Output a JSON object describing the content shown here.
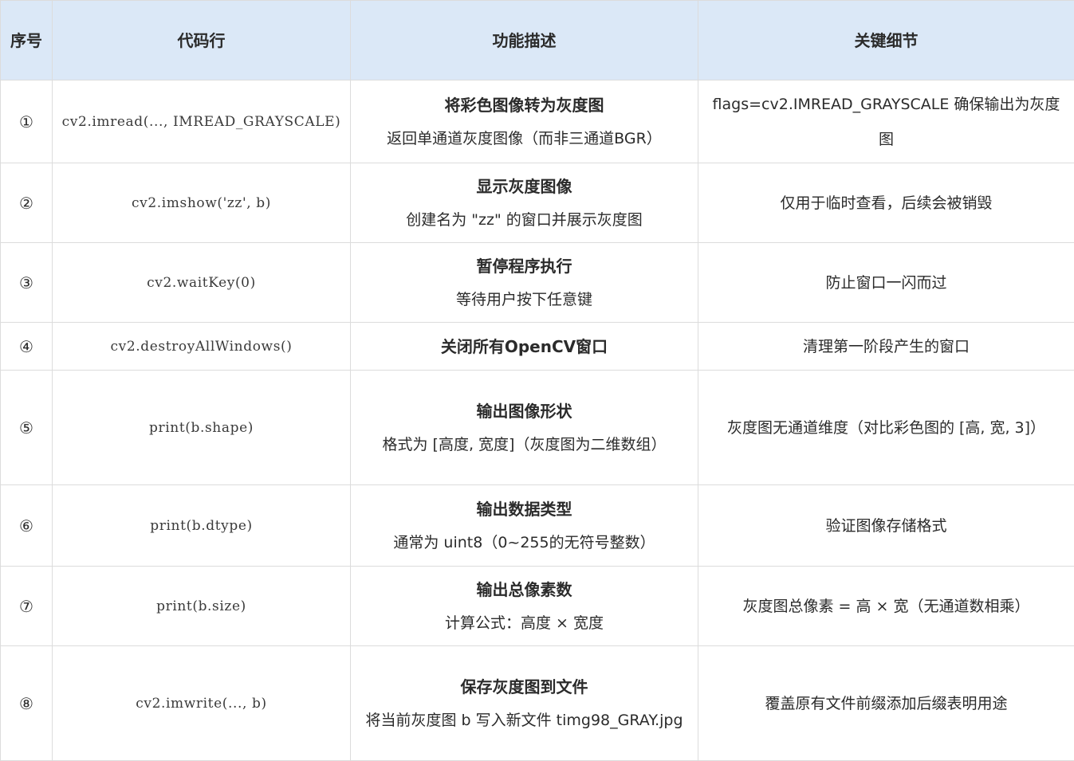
{
  "headers": {
    "num": "序号",
    "code": "代码行",
    "desc": "功能描述",
    "detail": "关键细节"
  },
  "rows": [
    {
      "num": "①",
      "code": "cv2.imread(..., IMREAD_GRAYSCALE)",
      "title": "将彩色图像转为灰度图",
      "sub": "返回单通道灰度图像（而非三通道BGR）",
      "detail": "flags=cv2.IMREAD_GRAYSCALE 确保输出为灰度图"
    },
    {
      "num": "②",
      "code": "cv2.imshow('zz', b)",
      "title": "显示灰度图像",
      "sub": "创建名为 \"zz\" 的窗口并展示灰度图",
      "detail": "仅用于临时查看，后续会被销毁"
    },
    {
      "num": "③",
      "code": "cv2.waitKey(0)",
      "title": "暂停程序执行",
      "sub": "等待用户按下任意键",
      "detail": "防止窗口一闪而过"
    },
    {
      "num": "④",
      "code": "cv2.destroyAllWindows()",
      "title": "关闭所有OpenCV窗口",
      "sub": "",
      "detail": "清理第一阶段产生的窗口"
    },
    {
      "num": "⑤",
      "code": "print(b.shape)",
      "title": "输出图像形状",
      "sub": "格式为 [高度, 宽度]（灰度图为二维数组）",
      "detail": "灰度图无通道维度（对比彩色图的 [高, 宽, 3]）"
    },
    {
      "num": "⑥",
      "code": "print(b.dtype)",
      "title": "输出数据类型",
      "sub": "通常为 uint8（0~255的无符号整数）",
      "detail": "验证图像存储格式"
    },
    {
      "num": "⑦",
      "code": "print(b.size)",
      "title": "输出总像素数",
      "sub": "计算公式：高度 × 宽度",
      "detail": "灰度图总像素 = 高 × 宽（无通道数相乘）"
    },
    {
      "num": "⑧",
      "code": "cv2.imwrite(..., b)",
      "title": "保存灰度图到文件",
      "sub": "将当前灰度图 b 写入新文件 timg98_GRAY.jpg",
      "detail": "覆盖原有文件前缀添加后缀表明用途"
    }
  ]
}
